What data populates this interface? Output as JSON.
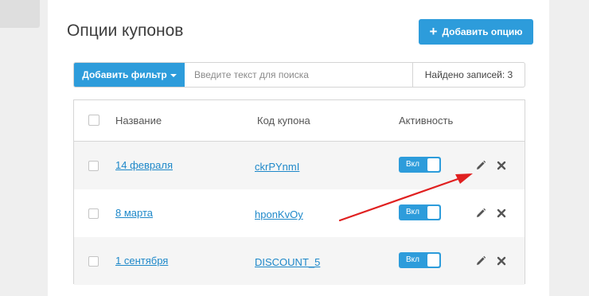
{
  "page": {
    "title": "Опции купонов"
  },
  "actions": {
    "add_option_label": "Добавить опцию"
  },
  "filter": {
    "add_filter_label": "Добавить фильтр",
    "search_placeholder": "Введите текст для поиска",
    "found_label": "Найдено записей: 3"
  },
  "table": {
    "columns": {
      "name": "Название",
      "code": "Код купона",
      "active": "Активность"
    },
    "rows": [
      {
        "name": "14 февраля",
        "code": "ckrPYnmI",
        "toggle": "Вкл"
      },
      {
        "name": "8 марта",
        "code": "hponKvOy",
        "toggle": "Вкл"
      },
      {
        "name": "1 сентября",
        "code": "DISCOUNT_5",
        "toggle": "Вкл"
      }
    ]
  },
  "colors": {
    "accent": "#2d9cdb",
    "link": "#1e88c9",
    "annotation_arrow": "#e02020"
  }
}
